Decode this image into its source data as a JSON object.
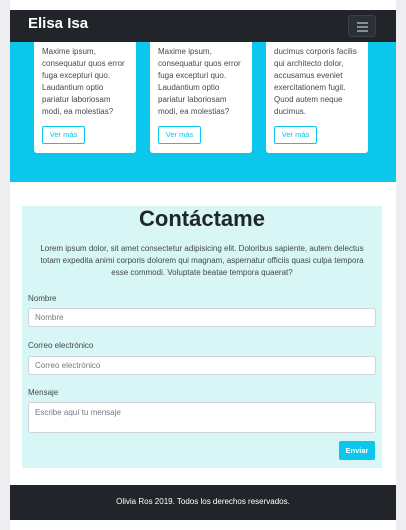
{
  "navbar": {
    "brand": "Elisa Isa",
    "toggler_icon": "hamburger-icon"
  },
  "cards": [
    {
      "text": "Maxime ipsum, consequatur quos error fuga excepturi quo. Laudantium optio pariatur laboriosam modi, ea molestias?",
      "button": "Ver más"
    },
    {
      "text": "Maxime ipsum, consequatur quos error fuga excepturi quo. Laudantium optio pariatur laboriosam modi, ea molestias?",
      "button": "Ver más"
    },
    {
      "text": "ducimus corporis facilis qui architecto dolor, accusamus eveniet exercitationem fugit. Quod autem neque ducimus.",
      "button": "Ver más"
    }
  ],
  "contact": {
    "title": "Contáctame",
    "lead": "Lorem ipsum dolor, sit amet consectetur adipisicing elit. Doloribus sapiente, autem delectus totam expedita animi corporis dolorem qui magnam, aspernatur officiis quasi culpa tempora esse commodi. Voluptate beatae tempora quaerat?",
    "name_label": "Nombre",
    "name_placeholder": "Nombre",
    "name_value": "",
    "email_label": "Correo electrónico",
    "email_placeholder": "Correo electrónico",
    "email_value": "",
    "message_label": "Mensaje",
    "message_placeholder": "Escribe aquí tu mensaje",
    "message_value": "",
    "send_label": "Enviar"
  },
  "footer": {
    "text": "Olivia Ros 2019. Todos los derechos reservados."
  },
  "colors": {
    "accent": "#0bc7ec",
    "dark": "#212529",
    "contact_bg": "#d9f6f6"
  }
}
